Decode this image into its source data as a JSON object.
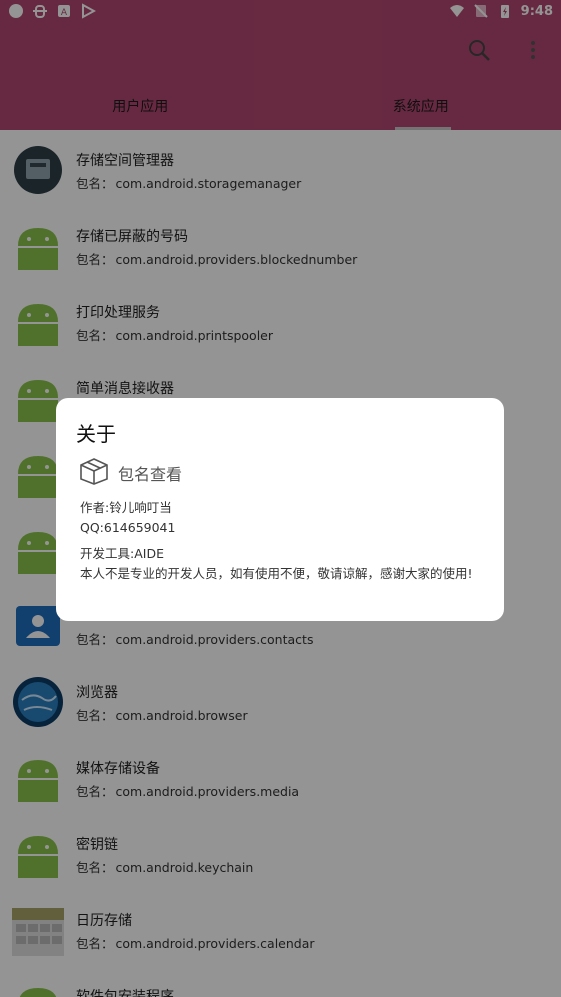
{
  "status_bar": {
    "time": "9:48",
    "left_icons": [
      "circle-icon",
      "bug-icon",
      "text-icon",
      "play-icon"
    ],
    "right_icons": [
      "wifi-icon",
      "no-sim-icon",
      "battery-icon"
    ]
  },
  "toolbar": {
    "search_icon": "search-icon",
    "more_icon": "more-vert-icon"
  },
  "tabs": [
    {
      "label": "用户应用",
      "active": false
    },
    {
      "label": "系统应用",
      "active": true
    }
  ],
  "list": {
    "pkg_label": "包名：",
    "items": [
      {
        "title": "存储空间管理器",
        "pkg": "com.android.storagemanager",
        "icon": "storage-manager-icon"
      },
      {
        "title": "存储已屏蔽的号码",
        "pkg": "com.android.providers.blockednumber",
        "icon": "android-robot-icon"
      },
      {
        "title": "打印处理服务",
        "pkg": "com.android.printspooler",
        "icon": "android-robot-icon"
      },
      {
        "title": "简单消息接收器",
        "pkg": "",
        "icon": "android-robot-icon"
      },
      {
        "title": "",
        "pkg": "",
        "icon": "android-robot-icon"
      },
      {
        "title": "",
        "pkg": "",
        "icon": "android-robot-icon"
      },
      {
        "title": "",
        "pkg": "com.android.providers.contacts",
        "icon": "contacts-icon"
      },
      {
        "title": "浏览器",
        "pkg": "com.android.browser",
        "icon": "globe-icon"
      },
      {
        "title": "媒体存储设备",
        "pkg": "com.android.providers.media",
        "icon": "android-robot-icon"
      },
      {
        "title": "密钥链",
        "pkg": "com.android.keychain",
        "icon": "android-robot-icon"
      },
      {
        "title": "日历存储",
        "pkg": "com.android.providers.calendar",
        "icon": "calendar-icon"
      },
      {
        "title": "软件包安装程序",
        "pkg": "",
        "icon": "android-robot-icon"
      }
    ]
  },
  "dialog": {
    "title": "关于",
    "app_icon": "package-box-icon",
    "app_name": "包名查看",
    "author": "作者:铃儿响叮当",
    "qq": "QQ:614659041",
    "tool": "开发工具:AIDE",
    "description": "本人不是专业的开发人员，如有使用不便，敬请谅解，感谢大家的使用!"
  },
  "colors": {
    "toolbar": "#b24870",
    "android_green": "#8bc34a",
    "scrim": "rgba(0,0,0,0.42)"
  }
}
